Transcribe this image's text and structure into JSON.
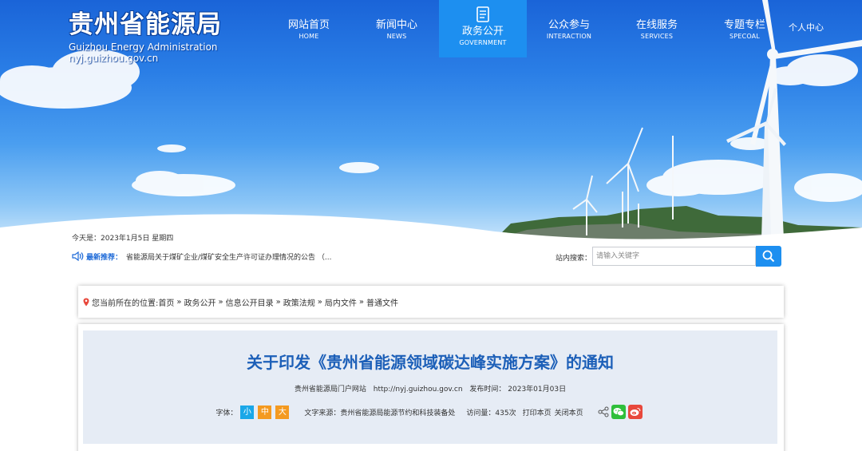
{
  "site": {
    "title_cn": "贵州省能源局",
    "title_en": "Guizhou Energy Administration",
    "url": "nyj.guizhou.gov.cn"
  },
  "nav": {
    "items": [
      {
        "cn": "网站首页",
        "en": "HOME"
      },
      {
        "cn": "新闻中心",
        "en": "NEWS"
      },
      {
        "cn": "政务公开",
        "en": "GOVERNMENT"
      },
      {
        "cn": "公众参与",
        "en": "INTERACTION"
      },
      {
        "cn": "在线服务",
        "en": "SERVICES"
      },
      {
        "cn": "专题专栏",
        "en": "SPECOAL"
      }
    ],
    "personal": "个人中心"
  },
  "info": {
    "today": "今天是：2023年1月5日 星期四",
    "recommend_label": "最新推荐：",
    "recommend_text": "省能源局关于煤矿企业/煤矿安全生产许可证办理情况的公告 （..."
  },
  "search": {
    "label": "站内搜索：",
    "placeholder": "请输入关键字"
  },
  "breadcrumb": {
    "prefix": "您当前所在的位置: ",
    "items": [
      "首页",
      "政务公开",
      "信息公开目录",
      "政策法规",
      "局内文件",
      "普通文件"
    ],
    "sep": "»"
  },
  "article": {
    "title": "关于印发《贵州省能源领域碳达峰实施方案》的通知",
    "publisher": "贵州省能源局门户网站",
    "pub_url": "http://nyj.guizhou.gov.cn",
    "date": "发布时间：  2023年01月03日",
    "font_label": "字体：",
    "font_small": "小",
    "font_medium": "中",
    "font_large": "大",
    "source": "文字来源：贵州省能源局能源节约和科技装备处",
    "visits": "访问量：435次",
    "print": "打印本页",
    "close": "关闭本页"
  },
  "colors": {
    "nav_active": "#1d8ff0",
    "title_blue": "#1c5fb8",
    "font_small_bg": "#1aa7e8",
    "font_med_bg": "#f49a20",
    "wechat": "#2fbf3b",
    "weibo": "#e8483c"
  }
}
